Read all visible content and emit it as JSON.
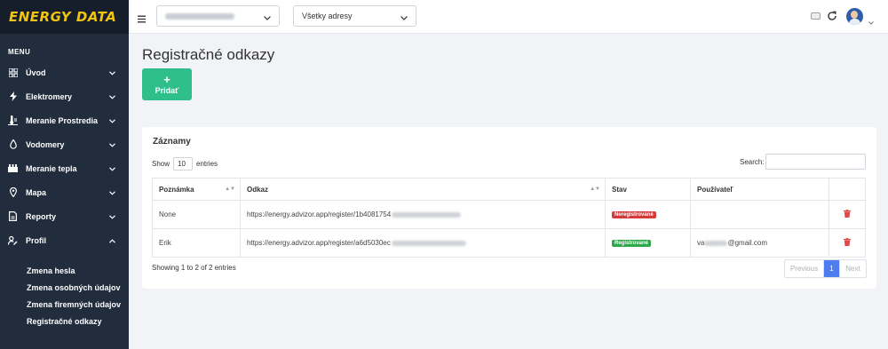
{
  "app": {
    "logo": "ENERGY DATA"
  },
  "sidebar": {
    "menu_header": "MENU",
    "items": [
      {
        "label": "Úvod",
        "icon": "dashboard-icon",
        "chevron": "down"
      },
      {
        "label": "Elektromery",
        "icon": "bolt-icon",
        "chevron": "down"
      },
      {
        "label": "Meranie Prostredia",
        "icon": "environment-icon",
        "chevron": "down"
      },
      {
        "label": "Vodomery",
        "icon": "water-drop-icon",
        "chevron": "down"
      },
      {
        "label": "Meranie tepla",
        "icon": "heat-icon",
        "chevron": "down"
      },
      {
        "label": "Mapa",
        "icon": "map-pin-icon",
        "chevron": "down"
      },
      {
        "label": "Reporty",
        "icon": "report-icon",
        "chevron": "down"
      },
      {
        "label": "Profil",
        "icon": "user-edit-icon",
        "chevron": "up"
      }
    ],
    "sub_items": [
      {
        "label": "Zmena hesla"
      },
      {
        "label": "Zmena osobných údajov"
      },
      {
        "label": "Zmena firemných údajov"
      },
      {
        "label": "Registračné odkazy"
      }
    ]
  },
  "topbar": {
    "company_select_value": "",
    "address_select_value": "Všetky adresy"
  },
  "main": {
    "title": "Registračné odkazy",
    "add_button_label": "Pridať",
    "card": {
      "title": "Záznamy",
      "show_label": "Show",
      "entries_value": "10",
      "entries_label": "entries",
      "search_label": "Search:",
      "columns": [
        "Poznámka",
        "Odkaz",
        "Stav",
        "Používateľ"
      ],
      "rows": [
        {
          "note": "None",
          "link": "https://energy.advizor.app/register/1b4081754",
          "status": "Neregistrované",
          "status_color": "#d63b3b",
          "user": ""
        },
        {
          "note": "Erik",
          "link": "https://energy.advizor.app/register/a6d5030ec",
          "status": "Registrované",
          "status_color": "#2ea84a",
          "user_prefix": "va",
          "user_suffix": "@gmail.com"
        }
      ],
      "info": "Showing 1 to 2 of 2 entries",
      "pagination": {
        "previous": "Previous",
        "current": "1",
        "next": "Next"
      }
    }
  }
}
